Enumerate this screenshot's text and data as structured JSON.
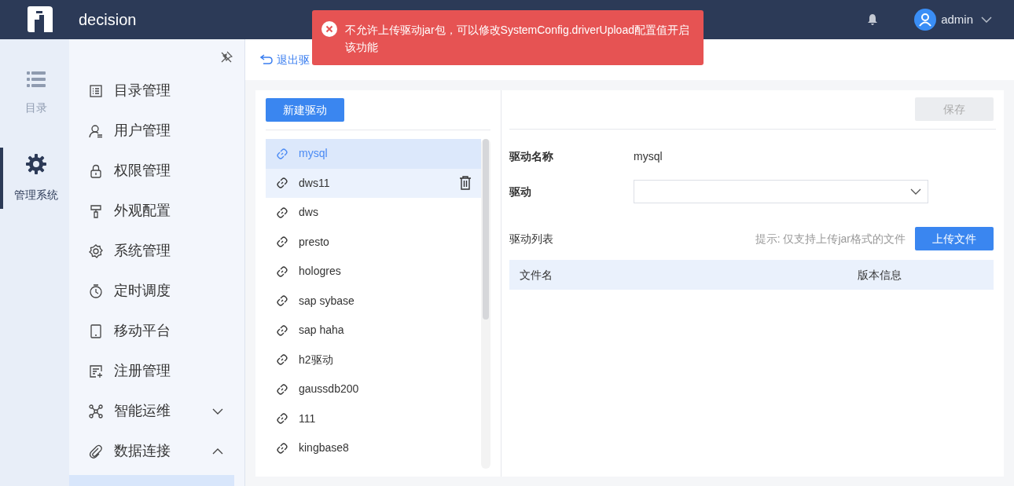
{
  "header": {
    "app_name": "decision",
    "user": "admin"
  },
  "toast": {
    "kind": "error",
    "message": "不允许上传驱动jar包，可以修改SystemConfig.driverUpload配置值开启该功能"
  },
  "rail": [
    {
      "label": "目录",
      "selected": false
    },
    {
      "label": "管理系统",
      "selected": true
    }
  ],
  "menu": [
    {
      "label": "目录管理"
    },
    {
      "label": "用户管理"
    },
    {
      "label": "权限管理"
    },
    {
      "label": "外观配置"
    },
    {
      "label": "系统管理"
    },
    {
      "label": "定时调度"
    },
    {
      "label": "移动平台"
    },
    {
      "label": "注册管理"
    },
    {
      "label": "智能运维",
      "expanded": false
    },
    {
      "label": "数据连接",
      "expanded": true
    }
  ],
  "back_link": "退出驱",
  "new_button": "新建驱动",
  "drivers": [
    {
      "name": "mysql",
      "selected": true,
      "hovered": false
    },
    {
      "name": "dws11",
      "selected": false,
      "hovered": true
    },
    {
      "name": "dws",
      "selected": false,
      "hovered": false
    },
    {
      "name": "presto",
      "selected": false,
      "hovered": false
    },
    {
      "name": "hologres",
      "selected": false,
      "hovered": false
    },
    {
      "name": "sap sybase",
      "selected": false,
      "hovered": false
    },
    {
      "name": "sap haha",
      "selected": false,
      "hovered": false
    },
    {
      "name": "h2驱动",
      "selected": false,
      "hovered": false
    },
    {
      "name": "gaussdb200",
      "selected": false,
      "hovered": false
    },
    {
      "name": "111",
      "selected": false,
      "hovered": false
    },
    {
      "name": "kingbase8",
      "selected": false,
      "hovered": false
    }
  ],
  "save_button": {
    "label": "保存",
    "disabled": true
  },
  "form": {
    "name_label": "驱动名称",
    "name_value": "mysql",
    "driver_label": "驱动"
  },
  "driver_list": {
    "title": "驱动列表",
    "hint": "提示: 仅支持上传jar格式的文件",
    "upload_button": "上传文件",
    "columns": [
      "文件名",
      "版本信息"
    ]
  }
}
